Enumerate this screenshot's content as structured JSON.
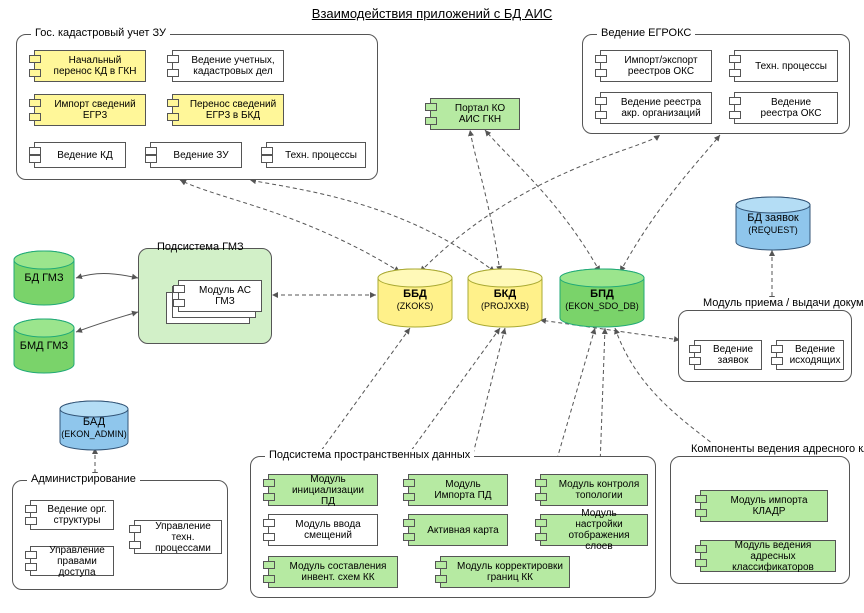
{
  "title": "Взаимодействия приложений с БД АИС",
  "groups": {
    "kadastr": "Гос. кадастровый учет ЗУ",
    "egroks": "Ведение ЕГРОКС",
    "gmz": "Подсистема ГМЗ",
    "admin": "Администрирование",
    "spatial": "Подсистема пространственных данных",
    "addr": "Компоненты ведения адресного классификатора",
    "docflow": "Модуль приема / выдачи документов"
  },
  "cyl": {
    "bdgmz": "БД ГМЗ",
    "bmdgmz": "БМД ГМЗ",
    "bad": {
      "name": "БАД",
      "sub": "(EKON_ADMIN)"
    },
    "bbd": {
      "name": "ББД",
      "sub": "(ZKOKS)"
    },
    "bkd": {
      "name": "БКД",
      "sub": "(PROJXXB)"
    },
    "bpd": {
      "name": "БПД",
      "sub": "(EKON_SDO_DB)"
    },
    "bdr": {
      "name": "БД заявок",
      "sub": "(REQUEST)"
    }
  },
  "comps": {
    "kad1": "Начальный перенос КД в ГКН",
    "kad2": "Ведение учетных, кадастровых дел",
    "kad3": "Импорт сведений ЕГР3",
    "kad4": "Перенос сведений ЕГР3 в БКД",
    "kad5": "Ведение КД",
    "kad6": "Ведение ЗУ",
    "kad7": "Техн. процессы",
    "egroks1": "Импорт/экспорт реестров ОКС",
    "egroks2": "Техн. процессы",
    "egroks3": "Ведение реестра акр. организаций",
    "egroks4": "Ведение реестра ОКС",
    "portal": "Портал КО АИС ГКН",
    "gmzmod": "Модуль АС ГМЗ",
    "admin1": "Ведение орг. структуры",
    "admin2": "Управление правами доступа",
    "admin3": "Управление техн. процессами",
    "sp1": "Модуль инициализации ПД",
    "sp2": "Модуль Импорта ПД",
    "sp3": "Модуль контроля топологии",
    "sp4": "Модуль ввода смещений",
    "sp5": "Активная карта",
    "sp6": "Модуль настройки отображения слоев",
    "sp7": "Модуль составления инвент. схем КК",
    "sp8": "Модуль корректировки границ КК",
    "addr1": "Модуль импорта КЛАДР",
    "addr2": "Модуль ведения адресных классификаторов",
    "doc1": "Ведение заявок",
    "doc2": "Ведение исходящих"
  }
}
